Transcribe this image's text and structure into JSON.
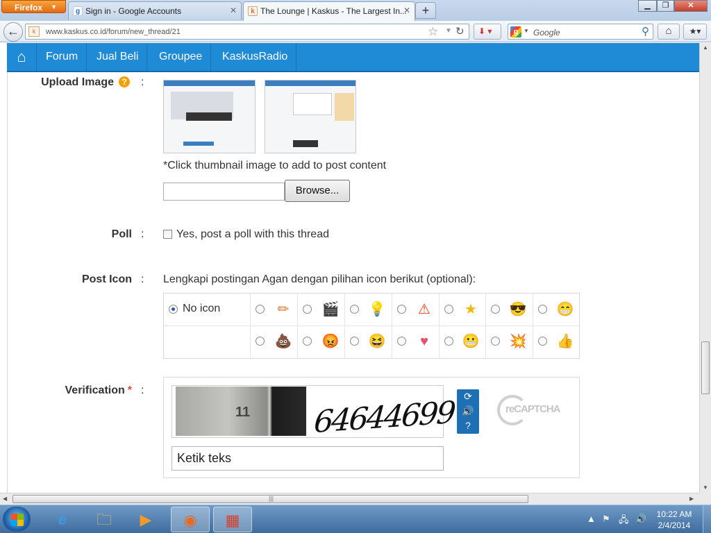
{
  "browser": {
    "menu_label": "Firefox",
    "tabs": [
      {
        "title": "Sign in - Google Accounts",
        "icon": "google-favicon"
      },
      {
        "title": "The Lounge | Kaskus - The Largest In...",
        "icon": "kaskus-favicon"
      }
    ],
    "new_tab_symbol": "+",
    "url": "www.kaskus.co.id/forum/new_thread/21",
    "search_placeholder": "Google"
  },
  "site_nav": {
    "items": [
      "Forum",
      "Jual Beli",
      "Groupee",
      "KaskusRadio"
    ]
  },
  "form": {
    "colon": ":",
    "upload": {
      "label": "Upload Image",
      "help": "?",
      "hint": "*Click thumbnail image to add to post content",
      "browse_label": "Browse..."
    },
    "poll": {
      "label": "Poll",
      "checkbox_label": "Yes, post a poll with this thread"
    },
    "post_icon": {
      "label": "Post Icon",
      "instruction": "Lengkapi postingan Agan dengan pilihan icon berikut (optional):",
      "no_icon_label": "No icon",
      "icons": [
        "pencil-icon",
        "clapperboard-icon",
        "lightbulb-icon",
        "warning-icon",
        "star-icon",
        "cool-smiley-icon",
        "grin-smiley-icon",
        "poop-icon",
        "angry-face-icon",
        "laughing-face-icon",
        "heart-icon",
        "cold-face-icon",
        "explosion-icon",
        "thumbs-up-icon"
      ]
    },
    "verification": {
      "label": "Verification",
      "required_mark": "*",
      "captcha_photo_number": "11",
      "captcha_word": "64644699",
      "input_value": "Ketik teks",
      "recaptcha_logo": "reCAPTCHA"
    }
  },
  "taskbar": {
    "time": "10:22 AM",
    "date": "2/4/2014"
  },
  "colors": {
    "site_nav": "#1f8ad6",
    "required": "#e04a3c",
    "help_badge": "#f59f00",
    "recaptcha_buttons": "#1f6fb5"
  }
}
